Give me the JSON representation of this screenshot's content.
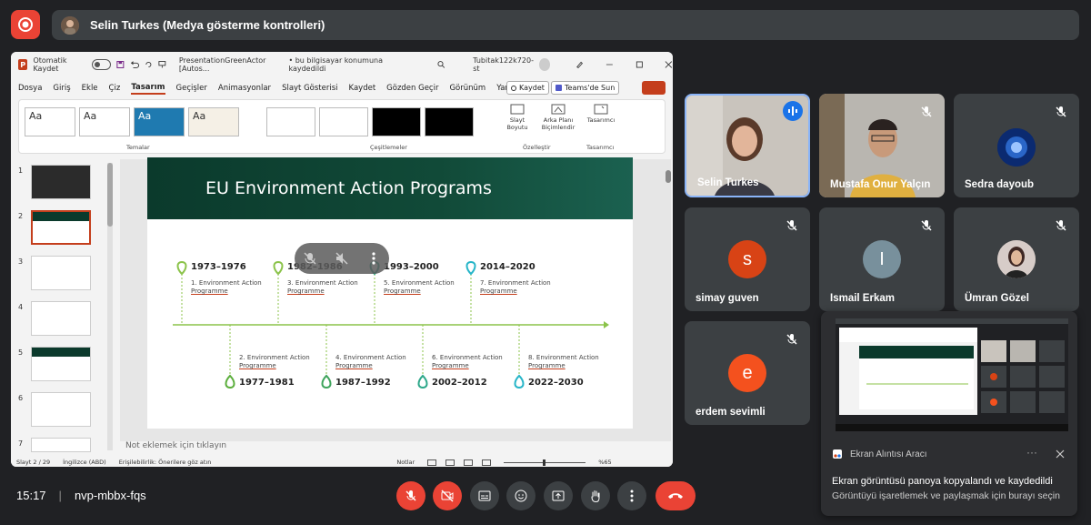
{
  "presenter_bar": {
    "label": "Selin Turkes (Medya gösterme kontrolleri)"
  },
  "ppt": {
    "autosave_label": "Otomatik Kaydet",
    "filename": "PresentationGreenActor [Autos...",
    "save_status": "• bu bilgisayar konumuna kaydedildi",
    "account": "Tubitak122k720-st",
    "menu": [
      "Dosya",
      "Giriş",
      "Ekle",
      "Çiz",
      "Tasarım",
      "Geçişler",
      "Animasyonlar",
      "Slayt Gösterisi",
      "Kaydet",
      "Gözden Geçir",
      "Görünüm",
      "Yardım"
    ],
    "active_menu": "Tasarım",
    "record_btn": "Kaydet",
    "teams_btn": "Teams'de Sun",
    "ribbon": {
      "themes_group": "Temalar",
      "variants_group": "Çeşitlemeler",
      "customize_group": "Özelleştir",
      "designer_group": "Tasarımcı",
      "slide_size": "Slayt Boyutu",
      "bg_format": "Arka Planı Biçimlendir",
      "designer": "Tasarımcı",
      "theme_sample": "Aa"
    },
    "slide_numbers": [
      "1",
      "2",
      "3",
      "4",
      "5",
      "6",
      "7"
    ],
    "slide": {
      "title": "EU Environment Action Programs",
      "top_items": [
        {
          "year": "1973–1976",
          "l1": "1. Environment Action",
          "l2": "Programme"
        },
        {
          "year": "1982–1986",
          "l1": "3. Environment Action",
          "l2": "Programme"
        },
        {
          "year": "1993–2000",
          "l1": "5. Environment Action",
          "l2": "Programme"
        },
        {
          "year": "2014–2020",
          "l1": "7. Environment Action",
          "l2": "Programme"
        }
      ],
      "bottom_items": [
        {
          "year": "1977–1981",
          "l1": "2. Environment Action",
          "l2": "Programme"
        },
        {
          "year": "1987–1992",
          "l1": "4. Environment Action",
          "l2": "Programme"
        },
        {
          "year": "2002–2012",
          "l1": "6. Environment Action",
          "l2": "Programme"
        },
        {
          "year": "2022–2030",
          "l1": "8. Environment Action",
          "l2": "Programme"
        }
      ]
    },
    "notes_placeholder": "Not eklemek için tıklayın",
    "status": {
      "slide": "Slayt 2 / 29",
      "language": "İngilizce (ABD)",
      "accessibility": "Erişilebilirlik: Önerilere göz atın",
      "notes": "Notlar",
      "zoom": "%65"
    }
  },
  "participants": [
    {
      "name": "Selin Turkes"
    },
    {
      "name": "Mustafa Onur Yalçın"
    },
    {
      "name": "Sedra dayoub"
    },
    {
      "name": "simay guven",
      "initial": "s"
    },
    {
      "name": "Ismail Erkam",
      "initial": "I"
    },
    {
      "name": "Ümran Gözel"
    },
    {
      "name": "erdem sevimli",
      "initial": "e"
    }
  ],
  "toast": {
    "app": "Ekran Alıntısı Aracı",
    "line1": "Ekran görüntüsü panoya kopyalandı ve kaydedildi",
    "line2": "Görüntüyü işaretlemek ve paylaşmak için burayı seçin"
  },
  "bottom": {
    "time": "15:17",
    "meeting_code": "nvp-mbbx-fqs"
  },
  "colors": {
    "accent_red": "#ea4335",
    "speaking_blue": "#1a73e8",
    "slide_green": "#0b3a2c"
  }
}
